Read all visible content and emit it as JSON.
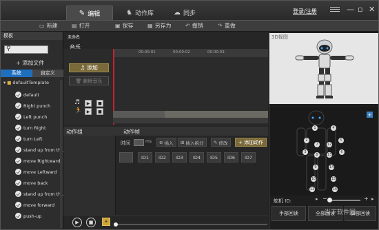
{
  "titlebar": {
    "tabs": [
      {
        "label": "编辑",
        "icon": "edit-icon"
      },
      {
        "label": "动作库",
        "icon": "robot-icon"
      },
      {
        "label": "同步",
        "icon": "sync-icon"
      }
    ],
    "login_label": "登录/注册"
  },
  "toolbar": {
    "new_label": "新建",
    "open_label": "打开",
    "save_label": "保存",
    "saveas_label": "另存为",
    "undo_label": "撤销",
    "redo_label": "重做"
  },
  "left": {
    "title": "模板",
    "add_file_label": "添加文件",
    "subtabs": [
      "系统",
      "自定义"
    ],
    "template_folder": "defaultTemplate",
    "items": [
      "default",
      "Right punch",
      "Left punch",
      "turn Right",
      "turn Left",
      "stand up from th...",
      "move Rightward",
      "move Leftward",
      "move back",
      "stand up from th...",
      "move forward",
      "push-up"
    ]
  },
  "center": {
    "doc_name": "未命名",
    "music_label": "音乐",
    "add_label": "添加",
    "delete_music_label": "删除音乐",
    "ticks": [
      "00:00:01",
      "00:00:02",
      "00:00:03"
    ],
    "action_group_label": "动作组",
    "action_frame_label": "动作帧",
    "time_label": "时间",
    "ms_label": "ms",
    "insert_label": "插入",
    "insert_split_label": "插入拆分",
    "modify_label": "修改",
    "add_action_label": "添加动作",
    "ids": [
      "ID1",
      "ID2",
      "ID3",
      "ID4",
      "ID5",
      "ID6",
      "ID7"
    ]
  },
  "right": {
    "view_label": "3D视图",
    "servo_label": "舵机 ID:",
    "joints": [
      "1",
      "2",
      "3",
      "4",
      "5",
      "6",
      "7",
      "8",
      "9",
      "10",
      "11",
      "12",
      "13",
      "14",
      "15",
      "16"
    ],
    "hand_reset_label": "手部回读",
    "all_reset_label": "全部回读",
    "leg_reset_label": "脚部回读",
    "watermark": "当下软件园"
  }
}
